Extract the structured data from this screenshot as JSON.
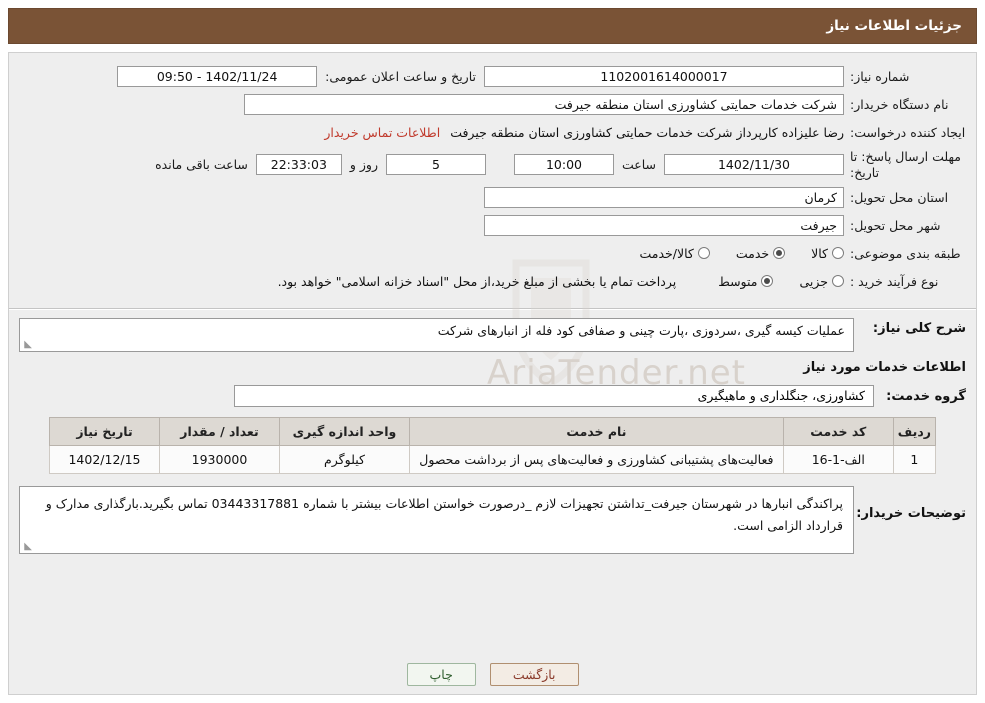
{
  "header": {
    "title": "جزئیات اطلاعات نیاز"
  },
  "watermark": {
    "text": "AriaTender.net"
  },
  "form": {
    "need_number_label": "شماره نیاز:",
    "need_number_value": "1102001614000017",
    "announce_datetime_label": "تاریخ و ساعت اعلان عمومی:",
    "announce_datetime_value": "1402/11/24 - 09:50",
    "buyer_org_label": "نام دستگاه خریدار:",
    "buyer_org_value": "شرکت خدمات حمایتی کشاورزی استان منطقه جیرفت",
    "requester_label": "ایجاد کننده درخواست:",
    "requester_value": "رضا علیزاده کارپرداز شرکت خدمات حمایتی کشاورزی استان منطقه جیرفت",
    "buyer_contact_link": "اطلاعات تماس خریدار",
    "deadline_label": "مهلت ارسال پاسخ: تا تاریخ:",
    "deadline_date": "1402/11/30",
    "hour_label": "ساعت",
    "deadline_time": "10:00",
    "days_remaining": "5",
    "days_label": "روز و",
    "time_remaining": "22:33:03",
    "remaining_suffix": "ساعت باقی مانده",
    "province_label": "استان محل تحویل:",
    "province_value": "کرمان",
    "city_label": "شهر محل تحویل:",
    "city_value": "جیرفت",
    "category_label": "طبقه بندی موضوعی:",
    "category_options": [
      {
        "label": "کالا",
        "selected": false
      },
      {
        "label": "خدمت",
        "selected": true
      },
      {
        "label": "کالا/خدمت",
        "selected": false
      }
    ],
    "process_label": "نوع فرآیند خرید :",
    "process_options": [
      {
        "label": "جزیی",
        "selected": false
      },
      {
        "label": "متوسط",
        "selected": true
      }
    ],
    "process_note": "پرداخت تمام یا بخشی از مبلغ خرید،از محل \"اسناد خزانه اسلامی\" خواهد بود."
  },
  "description": {
    "label": "شرح کلی نیاز:",
    "value": "عملیات کیسه گیری ،سردوزی ،پارت چینی و صفافی کود فله از انبارهای شرکت",
    "services_heading": "اطلاعات خدمات مورد نیاز",
    "group_label": "گروه خدمت:",
    "group_value": "کشاورزی، جنگلداری و ماهیگیری"
  },
  "table": {
    "columns": [
      "ردیف",
      "کد خدمت",
      "نام خدمت",
      "واحد اندازه گیری",
      "تعداد / مقدار",
      "تاریخ نیاز"
    ],
    "rows": [
      {
        "row": "1",
        "code": "الف-1-16",
        "name": "فعالیت‌های پشتیبانی کشاورزی و فعالیت‌های پس از برداشت محصول",
        "unit": "کیلوگرم",
        "qty": "1930000",
        "date": "1402/12/15"
      }
    ]
  },
  "notes": {
    "label": "توضیحات خریدار:",
    "value": "پراکندگی انبارها در شهرستان جیرفت_تداشتن تجهیزات لازم _درصورت خواستن اطلاعات بیشتر با شماره 03443317881 تماس بگیرید.بارگذاری مدارک و قرارداد الزامی است."
  },
  "footer": {
    "back_button": "بازگشت",
    "print_button": "چاپ"
  }
}
